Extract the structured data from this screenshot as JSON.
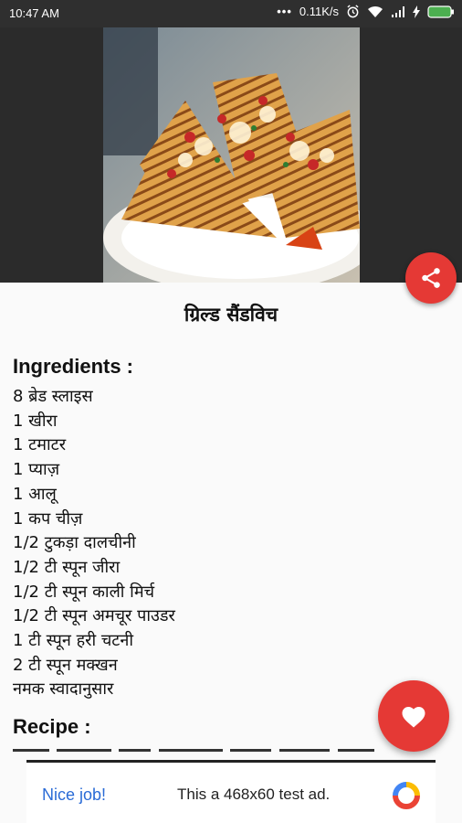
{
  "status_bar": {
    "time": "10:47 AM",
    "network_speed": "0.11K/s",
    "battery_color": "#4caf50"
  },
  "recipe": {
    "title": "ग्रिल्ड सैंडविच",
    "ingredients_heading": "Ingredients :",
    "ingredients": [
      " 8 ब्रेड स्लाइस",
      "1 खीरा",
      "1 टमाटर",
      "1 प्याज़",
      "1 आलू",
      "1 कप चीज़",
      "1/2 टुकड़ा दालचीनी",
      "1/2 टी स्पून जीरा",
      "1/2 टी स्पून काली मिर्च",
      "1/2 टी स्पून अमचूर पाउडर",
      "1 टी स्पून हरी चटनी",
      "2 टी स्पून मक्खन",
      "नमक स्वादानुसार"
    ],
    "recipe_heading": "Recipe :"
  },
  "buttons": {
    "share_icon": "share-icon",
    "favorite_icon": "heart-icon",
    "accent_color": "#e53935"
  },
  "ad": {
    "nice_job": "Nice job!",
    "message": "This a 468x60 test ad."
  }
}
